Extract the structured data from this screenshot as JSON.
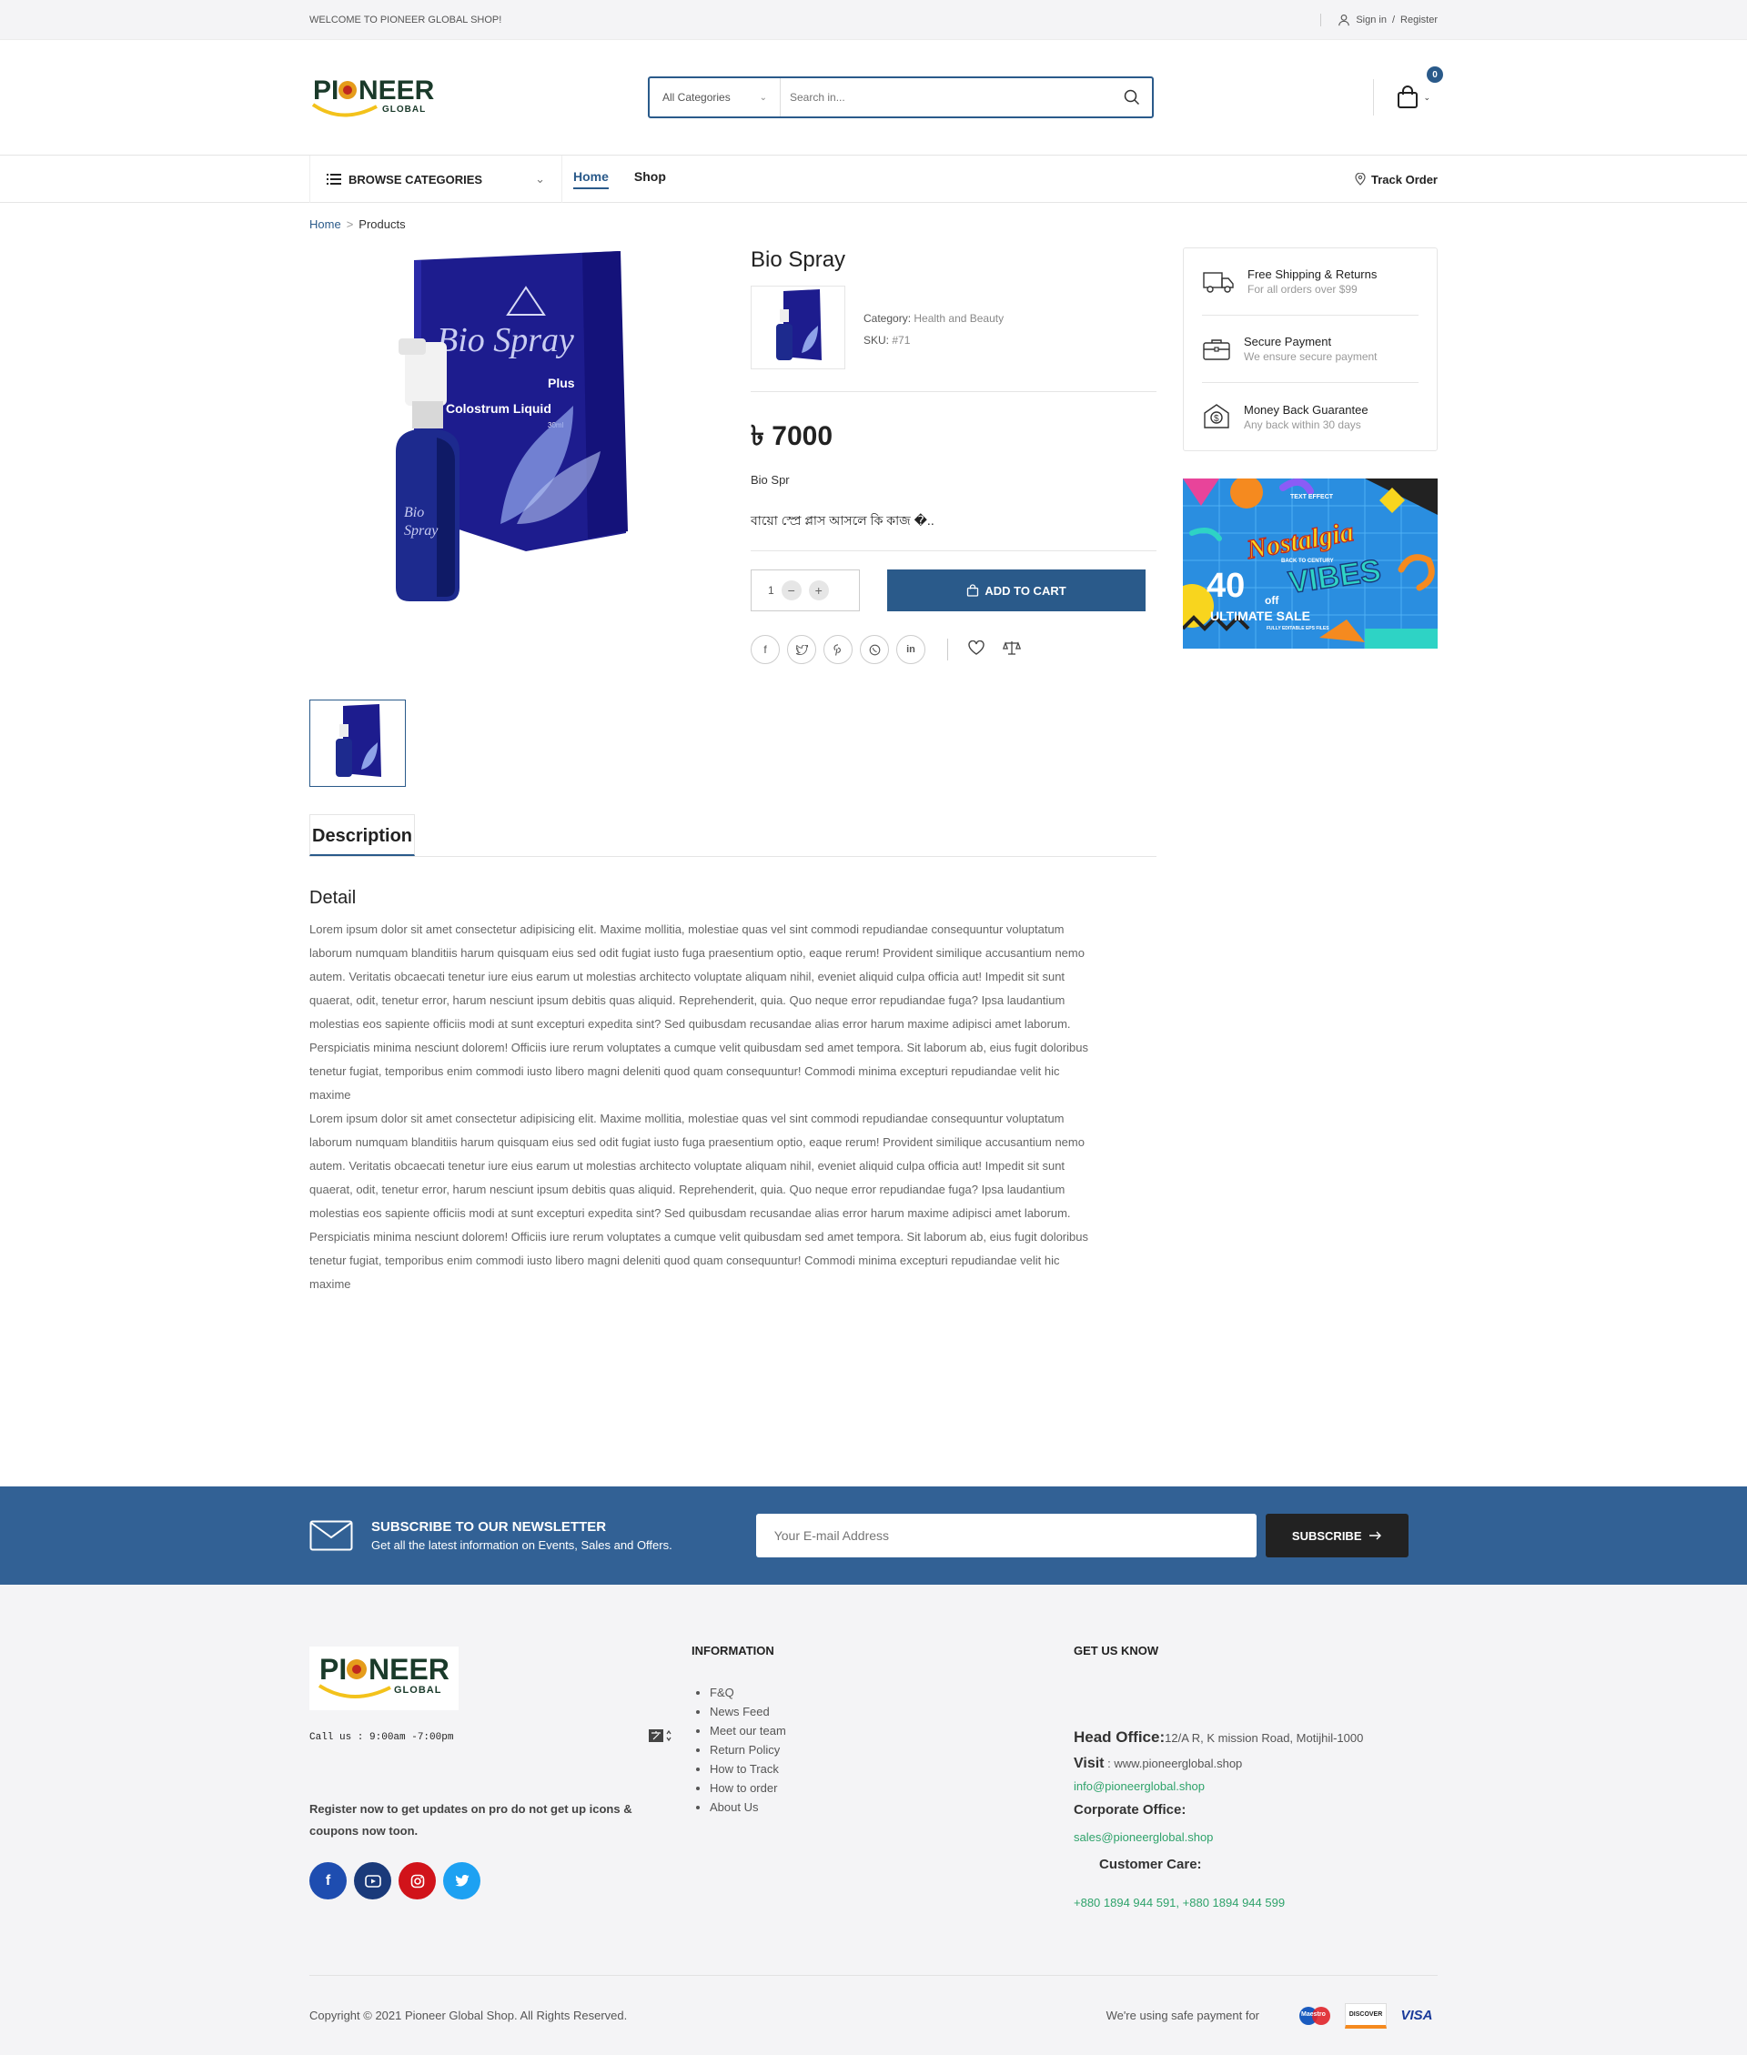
{
  "topbar": {
    "welcome": "WELCOME TO PIONEER GLOBAL SHOP!",
    "signin": "Sign in",
    "sep": "/",
    "register": "Register"
  },
  "header": {
    "logo_main": "PIONEER",
    "logo_sub": "GLOBAL",
    "search_category": "All Categories",
    "search_placeholder": "Search in...",
    "cart_count": "0"
  },
  "nav": {
    "browse": "BROWSE CATEGORIES",
    "links": [
      "Home",
      "Shop"
    ],
    "track": "Track Order"
  },
  "breadcrumb": {
    "home": "Home",
    "sep": ">",
    "current": "Products"
  },
  "product": {
    "title": "Bio Spray",
    "category_label": "Category:",
    "category_value": "Health and Beauty",
    "sku_label": "SKU:",
    "sku_value": "#71",
    "price": "৳ 7000",
    "short": "Bio Spr",
    "bangla": "বায়ো স্প্রে প্লাস আসলে কি কাজ �..",
    "qty": "1",
    "add_to_cart": "ADD TO CART",
    "box_brand": "Bio Spray",
    "box_plus": "Plus",
    "box_liquid": "Colostrum Liquid",
    "box_ml": "30ml"
  },
  "features": [
    {
      "title": "Free Shipping & Returns",
      "desc": "For all orders over $99",
      "icon": "truck-icon"
    },
    {
      "title": "Secure Payment",
      "desc": "We ensure secure payment",
      "icon": "briefcase-icon"
    },
    {
      "title": "Money Back Guarantee",
      "desc": "Any back within 30 days",
      "icon": "money-back-icon"
    }
  ],
  "banner": {
    "top": "TEXT EFFECT",
    "script": "Nostalgia",
    "ribbon": "BACK TO CENTURY",
    "big": "40",
    "off": "off",
    "vibes": "VIBES",
    "sale": "ULTIMATE SALE",
    "small": "FULLY EDITABLE EPS FILES"
  },
  "tabs": {
    "description": "Description"
  },
  "detail": {
    "heading": "Detail",
    "para1": "Lorem ipsum dolor sit amet consectetur adipisicing elit. Maxime mollitia, molestiae quas vel sint commodi repudiandae consequuntur voluptatum laborum numquam blanditiis harum quisquam eius sed odit fugiat iusto fuga praesentium optio, eaque rerum! Provident similique accusantium nemo autem. Veritatis obcaecati tenetur iure eius earum ut molestias architecto voluptate aliquam nihil, eveniet aliquid culpa officia aut! Impedit sit sunt quaerat, odit, tenetur error, harum nesciunt ipsum debitis quas aliquid. Reprehenderit, quia. Quo neque error repudiandae fuga? Ipsa laudantium molestias eos sapiente officiis modi at sunt excepturi expedita sint? Sed quibusdam recusandae alias error harum maxime adipisci amet laborum. Perspiciatis minima nesciunt dolorem! Officiis iure rerum voluptates a cumque velit quibusdam sed amet tempora. Sit laborum ab, eius fugit doloribus tenetur fugiat, temporibus enim commodi iusto libero magni deleniti quod quam consequuntur! Commodi minima excepturi repudiandae velit hic maxime",
    "para2": "Lorem ipsum dolor sit amet consectetur adipisicing elit. Maxime mollitia, molestiae quas vel sint commodi repudiandae consequuntur voluptatum laborum numquam blanditiis harum quisquam eius sed odit fugiat iusto fuga praesentium optio, eaque rerum! Provident similique accusantium nemo autem. Veritatis obcaecati tenetur iure eius earum ut molestias architecto voluptate aliquam nihil, eveniet aliquid culpa officia aut! Impedit sit sunt quaerat, odit, tenetur error, harum nesciunt ipsum debitis quas aliquid. Reprehenderit, quia. Quo neque error repudiandae fuga? Ipsa laudantium molestias eos sapiente officiis modi at sunt excepturi expedita sint? Sed quibusdam recusandae alias error harum maxime adipisci amet laborum. Perspiciatis minima nesciunt dolorem! Officiis iure rerum voluptates a cumque velit quibusdam sed amet tempora. Sit laborum ab, eius fugit doloribus tenetur fugiat, temporibus enim commodi iusto libero magni deleniti quod quam consequuntur! Commodi minima excepturi repudiandae velit hic maxime"
  },
  "newsletter": {
    "title": "SUBSCRIBE TO OUR NEWSLETTER",
    "desc": "Get all the latest information on Events, Sales and Offers.",
    "placeholder": "Your E-mail Address",
    "button": "SUBSCRIBE"
  },
  "footer": {
    "call": "Call us : 9:00am -7:00pm",
    "register_text": "Register now to get updates on pro do not get up icons & coupons now toon.",
    "info_heading": "INFORMATION",
    "info_links": [
      "F&Q",
      "News Feed",
      "Meet our team",
      "Return Policy",
      "How to Track",
      "How to order",
      "About Us"
    ],
    "know_heading": "GET US KNOW",
    "head_office_label": "Head Office:",
    "head_office_value": "12/A R, K mission Road, Motijhil-1000",
    "visit_label": "Visit",
    "visit_value": ": www.pioneerglobal.shop",
    "email1": "info@pioneerglobal.shop",
    "corporate_label": "Corporate Office:",
    "email2": "sales@pioneerglobal.shop",
    "care_label": "Customer Care:",
    "phones": "+880 1894 944 591, +880 1894 944 599",
    "copyright": "Copyright © 2021 Pioneer Global Shop. All Rights Reserved.",
    "safe_payment": "We're using safe payment for",
    "payments": [
      "Maestro",
      "DISCOVER",
      "VISA"
    ]
  },
  "colors": {
    "primary": "#2a5a8a",
    "newsletter": "#326195",
    "link_green": "#2fa36b"
  }
}
